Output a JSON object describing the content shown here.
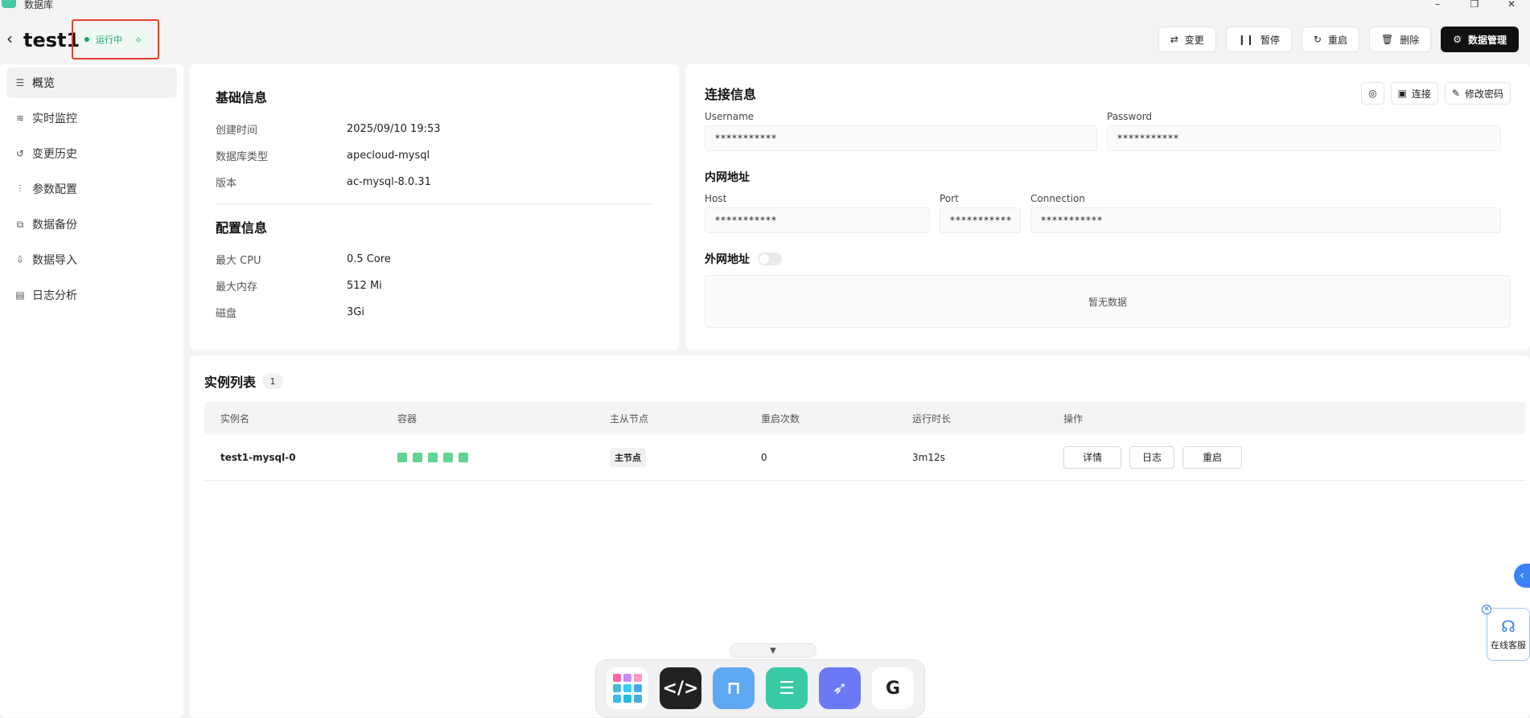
{
  "window": {
    "title": "数据库",
    "minimize": "–",
    "maximize": "❐",
    "close": "✕"
  },
  "header": {
    "title": "test1",
    "status": "运行中",
    "buttons": {
      "change": "变更",
      "pause": "暂停",
      "restart": "重启",
      "delete": "删除",
      "manage": "数据管理"
    }
  },
  "sidebar": {
    "items": [
      {
        "label": "概览",
        "icon": "overview-icon"
      },
      {
        "label": "实时监控",
        "icon": "monitor-icon"
      },
      {
        "label": "变更历史",
        "icon": "history-icon"
      },
      {
        "label": "参数配置",
        "icon": "sliders-icon"
      },
      {
        "label": "数据备份",
        "icon": "backup-icon"
      },
      {
        "label": "数据导入",
        "icon": "import-icon"
      },
      {
        "label": "日志分析",
        "icon": "log-icon"
      }
    ]
  },
  "basic": {
    "title": "基础信息",
    "rows": [
      {
        "k": "创建时间",
        "v": "2025/09/10 19:53"
      },
      {
        "k": "数据库类型",
        "v": "apecloud-mysql"
      },
      {
        "k": "版本",
        "v": "ac-mysql-8.0.31"
      }
    ],
    "config_title": "配置信息",
    "config_rows": [
      {
        "k": "最大 CPU",
        "v": "0.5 Core"
      },
      {
        "k": "最大内存",
        "v": "512 Mi"
      },
      {
        "k": "磁盘",
        "v": "3Gi"
      }
    ]
  },
  "connection": {
    "title": "连接信息",
    "connect_label": "连接",
    "change_password_label": "修改密码",
    "username_label": "Username",
    "username_value": "***********",
    "password_label": "Password",
    "password_value": "***********",
    "internal_title": "内网地址",
    "host_label": "Host",
    "host_value": "***********",
    "port_label": "Port",
    "port_value": "***********",
    "conn_label": "Connection",
    "conn_value": "***********",
    "external_title": "外网地址",
    "empty_text": "暂无数据"
  },
  "instances": {
    "title": "实例列表",
    "count": "1",
    "columns": [
      "实例名",
      "容器",
      "主从节点",
      "重启次数",
      "运行时长",
      "操作"
    ],
    "rows": [
      {
        "name": "test1-mysql-0",
        "containers": 5,
        "role": "主节点",
        "restarts": "0",
        "uptime": "3m12s"
      }
    ],
    "actions": {
      "detail": "详情",
      "log": "日志",
      "restart": "重启"
    }
  },
  "support": {
    "label": "在线客服"
  },
  "colors": {
    "accent": "#111111",
    "running": "#1aa56a",
    "container": "#5fd493",
    "highlight": "#e0412b"
  }
}
